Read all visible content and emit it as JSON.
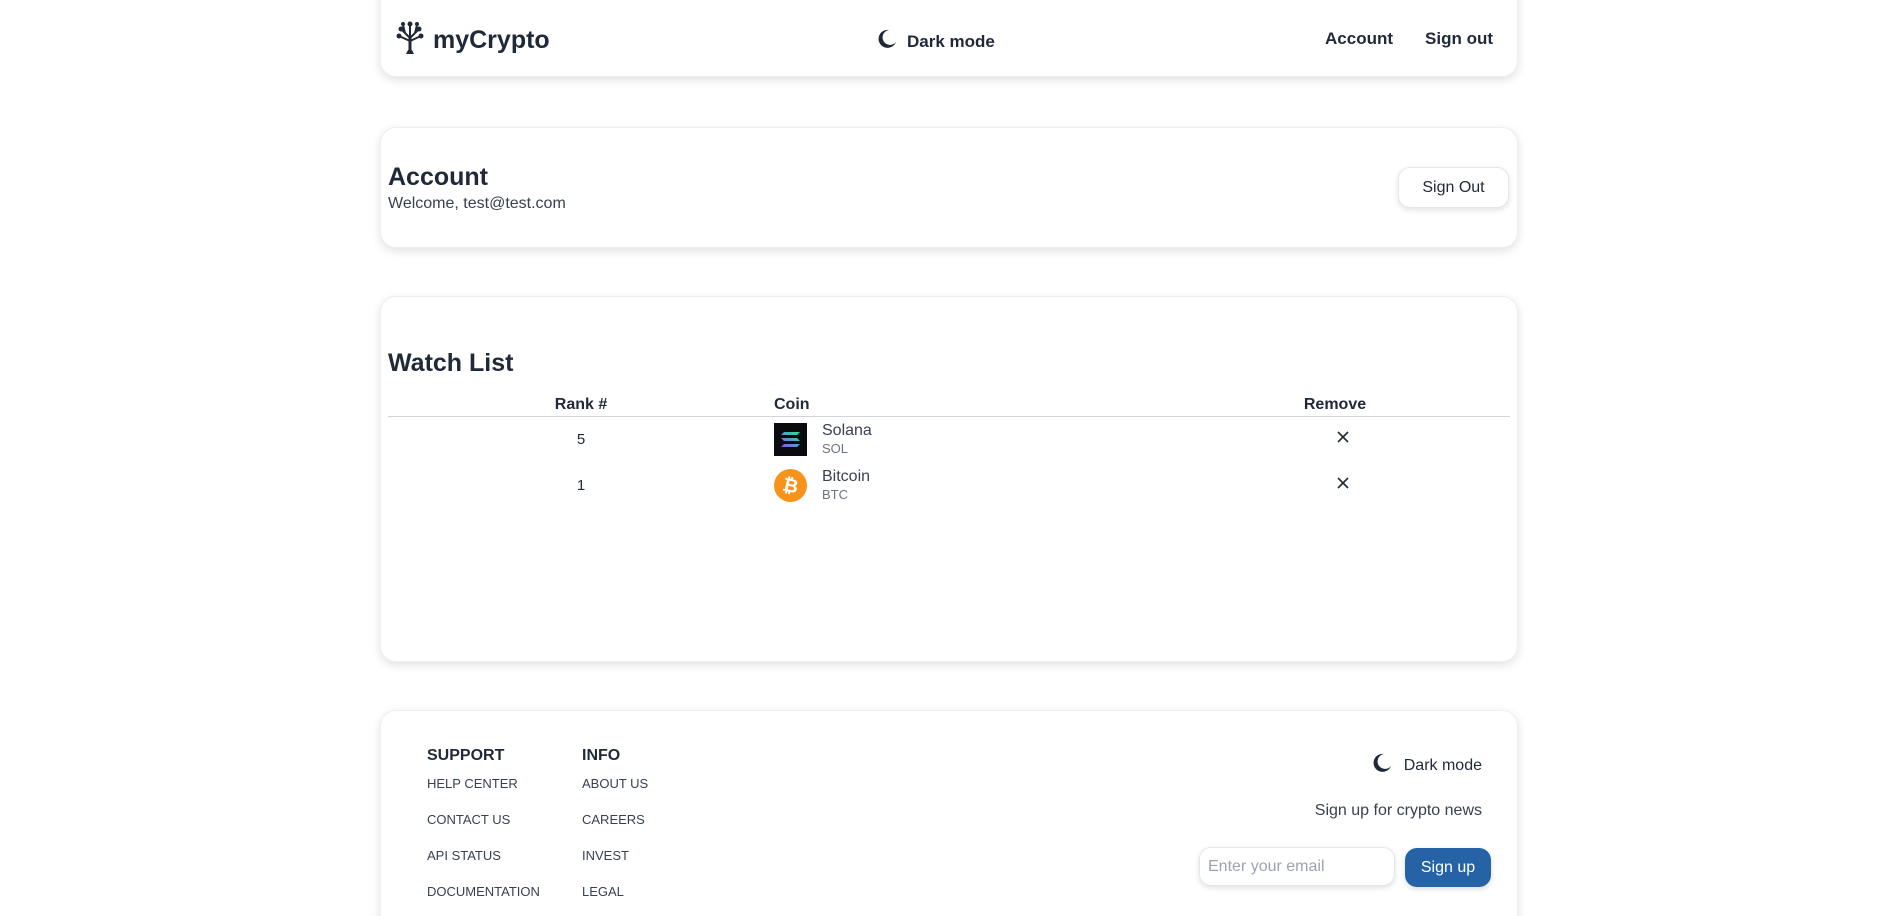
{
  "header": {
    "brand": "myCrypto",
    "dark_mode_label": "Dark mode",
    "nav": {
      "account": "Account",
      "sign_out": "Sign out"
    }
  },
  "account": {
    "title": "Account",
    "welcome": "Welcome, test@test.com",
    "sign_out_button": "Sign Out"
  },
  "watchlist": {
    "title": "Watch List",
    "columns": [
      "Rank #",
      "Coin",
      "Remove"
    ],
    "rows": [
      {
        "rank": "5",
        "name": "Solana",
        "symbol": "SOL",
        "icon": "solana-logo"
      },
      {
        "rank": "1",
        "name": "Bitcoin",
        "symbol": "BTC",
        "icon": "bitcoin-logo"
      }
    ]
  },
  "footer": {
    "support": {
      "heading": "SUPPORT",
      "links": [
        "HELP CENTER",
        "CONTACT US",
        "API STATUS",
        "DOCUMENTATION"
      ]
    },
    "info": {
      "heading": "INFO",
      "links": [
        "ABOUT US",
        "CAREERS",
        "INVEST",
        "LEGAL"
      ]
    },
    "dark_mode_label": "Dark mode",
    "newsletter_text": "Sign up for crypto news",
    "email_placeholder": "Enter your email",
    "signup_button": "Sign up"
  },
  "colors": {
    "accent": "#2563a6",
    "text": "#1f2937",
    "bitcoin": "#f7931a",
    "solana_bg": "#0b0b0f"
  }
}
